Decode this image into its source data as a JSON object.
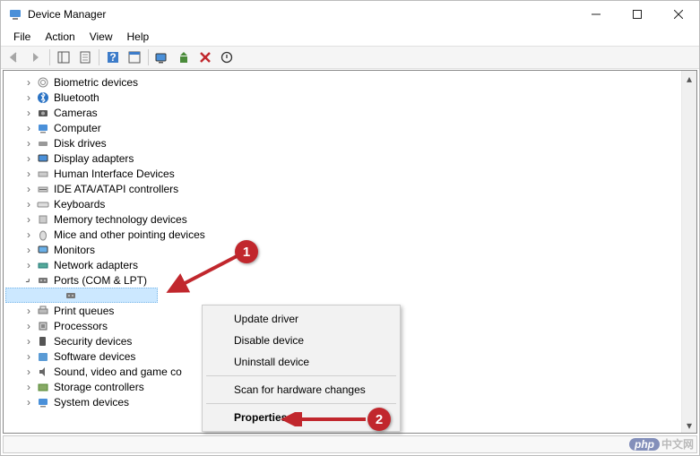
{
  "window": {
    "title": "Device Manager"
  },
  "menu": {
    "file": "File",
    "action": "Action",
    "view": "View",
    "help": "Help"
  },
  "tree": {
    "items": [
      {
        "label": "Biometric devices"
      },
      {
        "label": "Bluetooth"
      },
      {
        "label": "Cameras"
      },
      {
        "label": "Computer"
      },
      {
        "label": "Disk drives"
      },
      {
        "label": "Display adapters"
      },
      {
        "label": "Human Interface Devices"
      },
      {
        "label": "IDE ATA/ATAPI controllers"
      },
      {
        "label": "Keyboards"
      },
      {
        "label": "Memory technology devices"
      },
      {
        "label": "Mice and other pointing devices"
      },
      {
        "label": "Monitors"
      },
      {
        "label": "Network adapters"
      },
      {
        "label": "Ports (COM & LPT)"
      },
      {
        "label": "Print queues"
      },
      {
        "label": "Processors"
      },
      {
        "label": "Security devices"
      },
      {
        "label": "Software devices"
      },
      {
        "label": "Sound, video and game co"
      },
      {
        "label": "Storage controllers"
      },
      {
        "label": "System devices"
      }
    ]
  },
  "context_menu": {
    "update": "Update driver",
    "disable": "Disable device",
    "uninstall": "Uninstall device",
    "scan": "Scan for hardware changes",
    "properties": "Properties"
  },
  "annotations": {
    "one": "1",
    "two": "2"
  },
  "watermark": {
    "php": "php",
    "cn": "中文网"
  }
}
